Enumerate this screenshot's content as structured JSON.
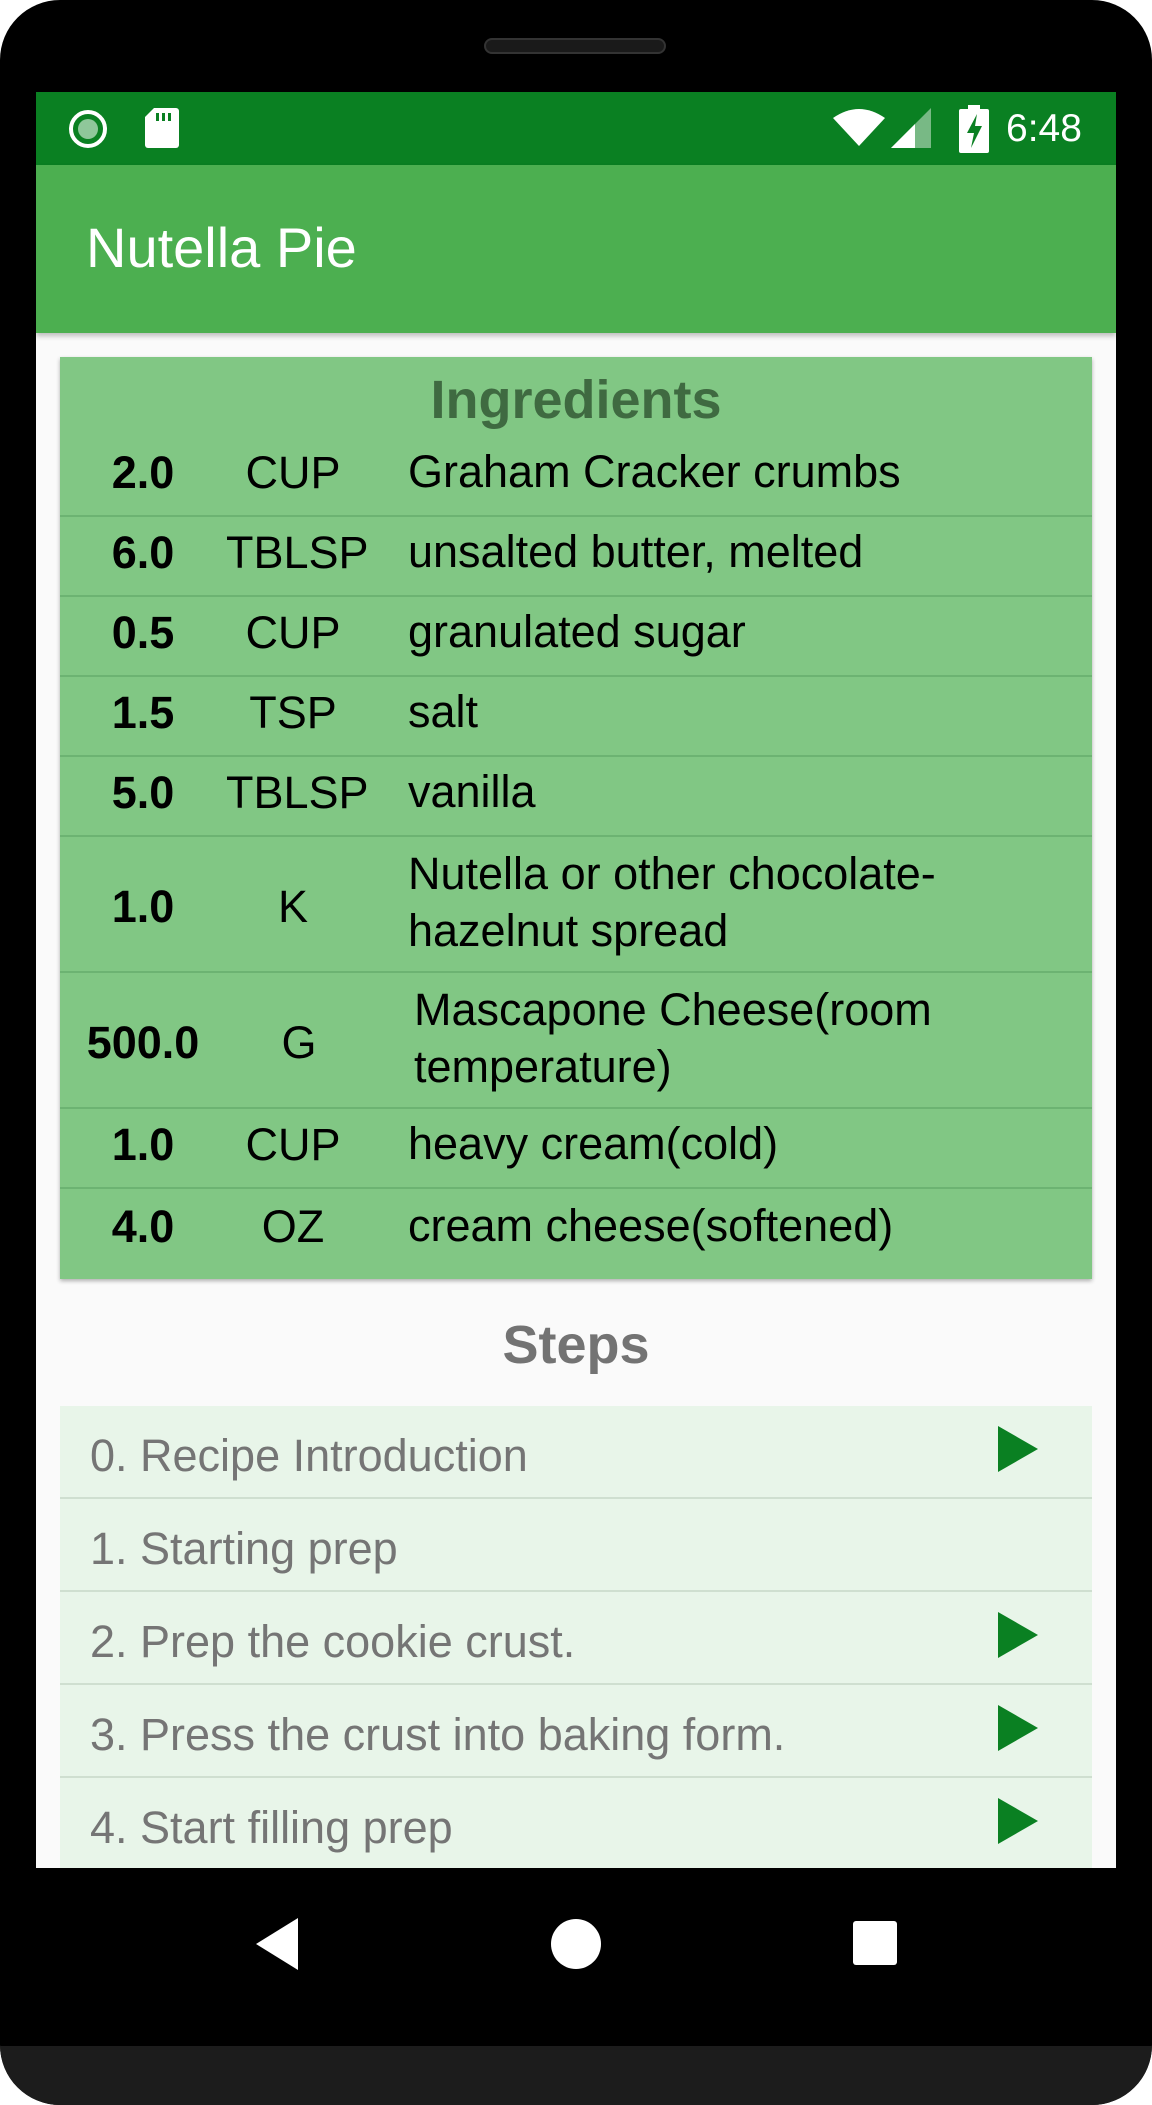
{
  "status_bar": {
    "time": "6:48",
    "icons": [
      "record-icon",
      "sd-card-icon",
      "wifi-icon",
      "signal-icon",
      "battery-charging-icon"
    ]
  },
  "app_bar": {
    "title": "Nutella Pie"
  },
  "ingredients": {
    "title": "Ingredients",
    "rows": [
      {
        "qty": "2.0",
        "unit": "CUP",
        "name": "Graham Cracker crumbs"
      },
      {
        "qty": "6.0",
        "unit": "TBLSP",
        "name": "unsalted butter, melted"
      },
      {
        "qty": "0.5",
        "unit": "CUP",
        "name": "granulated sugar"
      },
      {
        "qty": "1.5",
        "unit": "TSP",
        "name": "salt"
      },
      {
        "qty": "5.0",
        "unit": "TBLSP",
        "name": "vanilla"
      },
      {
        "qty": "1.0",
        "unit": "K",
        "name": "Nutella or other chocolate-hazelnut spread"
      },
      {
        "qty": "500.0",
        "unit": "G",
        "name": "Mascapone Cheese(room temperature)"
      },
      {
        "qty": "1.0",
        "unit": "CUP",
        "name": "heavy cream(cold)"
      },
      {
        "qty": "4.0",
        "unit": "OZ",
        "name": "cream cheese(softened)"
      }
    ]
  },
  "steps": {
    "title": "Steps",
    "items": [
      {
        "label": "0. Recipe Introduction",
        "has_video": true
      },
      {
        "label": "1. Starting prep",
        "has_video": false
      },
      {
        "label": "2. Prep the cookie crust.",
        "has_video": true
      },
      {
        "label": "3. Press the crust into baking form.",
        "has_video": true
      },
      {
        "label": "4. Start filling prep",
        "has_video": true
      }
    ]
  },
  "colors": {
    "status_bar": "#0a8022",
    "app_bar": "#4caf50",
    "ingredients_card": "#81c784",
    "step_row": "#e8f5e9",
    "play_icon": "#0a8022"
  },
  "nav_bar": {
    "icons": [
      "back-icon",
      "home-icon",
      "recents-icon"
    ]
  }
}
